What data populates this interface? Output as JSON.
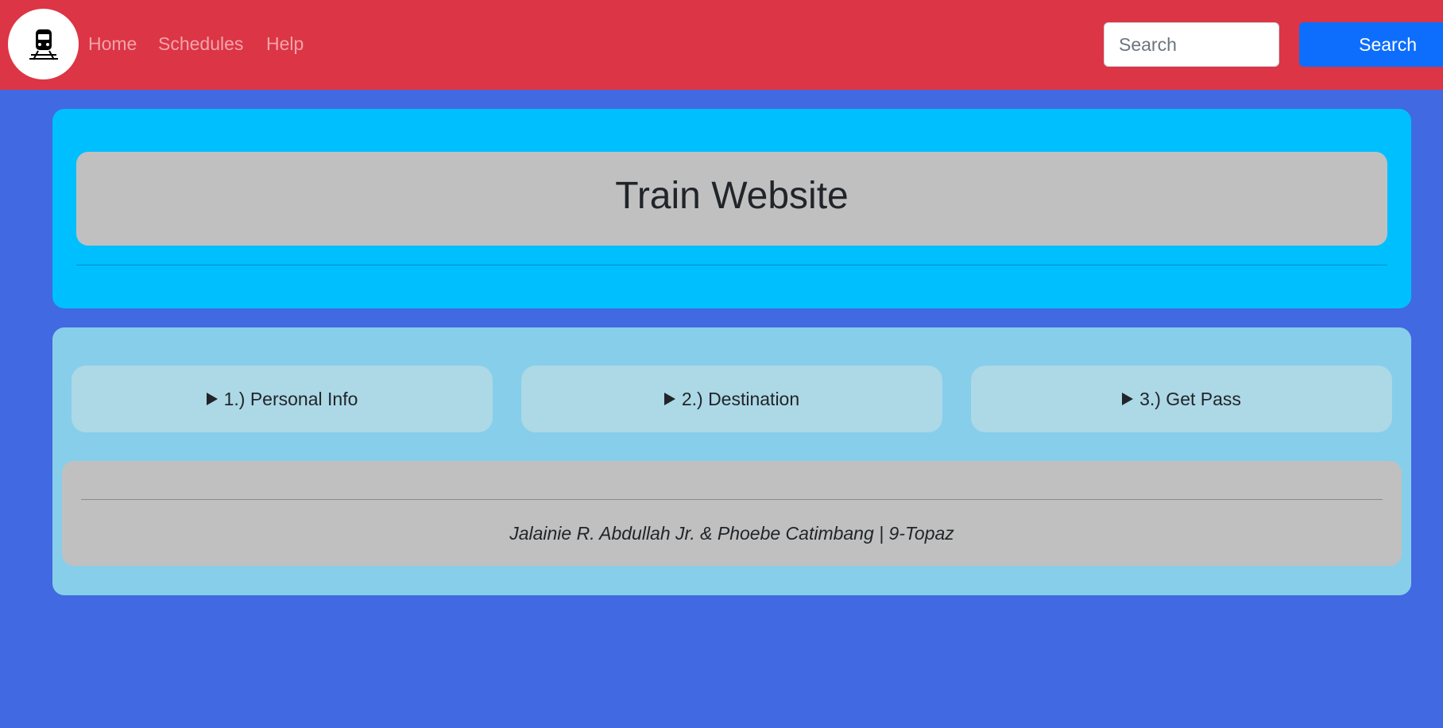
{
  "navbar": {
    "logo_icon": "train-icon",
    "links": [
      "Home",
      "Schedules",
      "Help"
    ],
    "search": {
      "placeholder": "Search",
      "value": ""
    },
    "search_button_label": "Search"
  },
  "hero": {
    "title": "Train Website"
  },
  "steps": [
    {
      "icon": "triangle-right-icon",
      "label": "1.) Personal Info"
    },
    {
      "icon": "triangle-right-icon",
      "label": "2.) Destination"
    },
    {
      "icon": "triangle-right-icon",
      "label": "3.) Get Pass"
    }
  ],
  "footer": {
    "credits": "Jalainie R. Abdullah Jr. & Phoebe Catimbang | 9-Topaz"
  },
  "colors": {
    "navbar": "#dc3545",
    "page_background": "#4169e1",
    "hero_background": "#00bfff",
    "panel_background": "#87ceeb",
    "step_background": "#add8e6",
    "box_gray": "#c0c0c0",
    "button_blue": "#0d6efd"
  }
}
